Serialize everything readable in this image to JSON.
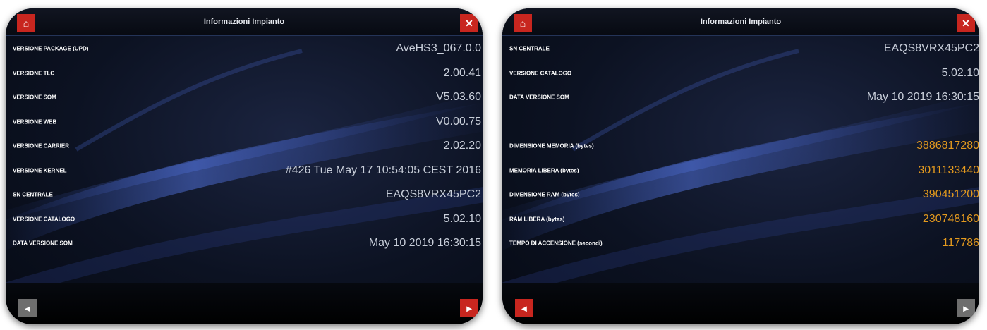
{
  "left_panel": {
    "title": "Informazioni Impianto",
    "rows": [
      {
        "label": "VERSIONE PACKAGE (UPD)",
        "value": "AveHS3_067.0.0"
      },
      {
        "label": "VERSIONE TLC",
        "value": "2.00.41"
      },
      {
        "label": "VERSIONE SOM",
        "value": "V5.03.60"
      },
      {
        "label": "VERSIONE WEB",
        "value": "V0.00.75"
      },
      {
        "label": "VERSIONE CARRIER",
        "value": "2.02.20"
      },
      {
        "label": "VERSIONE KERNEL",
        "value": "#426 Tue May 17 10:54:05 CEST 2016"
      },
      {
        "label": "SN CENTRALE",
        "value": "EAQS8VRX45PC2"
      },
      {
        "label": "VERSIONE CATALOGO",
        "value": "5.02.10"
      },
      {
        "label": "DATA VERSIONE SOM",
        "value": "May 10 2019 16:30:15"
      }
    ]
  },
  "right_panel": {
    "title": "Informazioni Impianto",
    "rows": [
      {
        "label": "SN CENTRALE",
        "value": "EAQS8VRX45PC2"
      },
      {
        "label": "VERSIONE CATALOGO",
        "value": "5.02.10"
      },
      {
        "label": "DATA VERSIONE SOM",
        "value": "May 10 2019 16:30:15"
      },
      {
        "label": "",
        "value": ""
      },
      {
        "label": "DIMENSIONE MEMORIA (bytes)",
        "value": "3886817280"
      },
      {
        "label": "MEMORIA LIBERA (bytes)",
        "value": "3011133440"
      },
      {
        "label": "DIMENSIONE RAM (bytes)",
        "value": "390451200"
      },
      {
        "label": "RAM LIBERA (bytes)",
        "value": "230748160"
      },
      {
        "label": "TEMPO DI ACCENSIONE (secondi)",
        "value": "117786"
      }
    ]
  },
  "icons": {
    "home": "home-icon",
    "close": "close-icon",
    "back": "back-icon",
    "forward": "forward-icon"
  },
  "colors": {
    "value_white": "#c9cfda",
    "value_orange": "#e49a1e",
    "button_red": "#c8261f"
  }
}
